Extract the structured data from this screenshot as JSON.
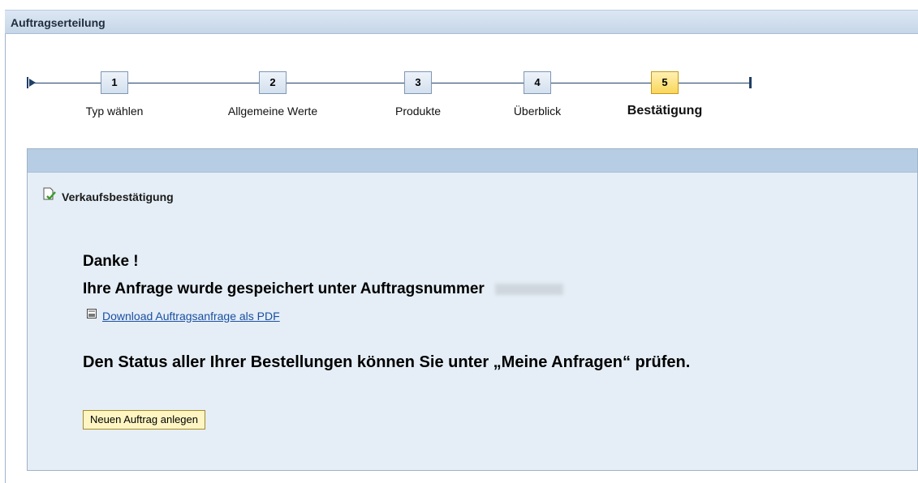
{
  "window": {
    "title": "Auftragserteilung"
  },
  "roadmap": {
    "steps": [
      {
        "number": "1",
        "label": "Typ wählen"
      },
      {
        "number": "2",
        "label": "Allgemeine Werte"
      },
      {
        "number": "3",
        "label": "Produkte"
      },
      {
        "number": "4",
        "label": "Überblick"
      },
      {
        "number": "5",
        "label": "Bestätigung"
      }
    ],
    "active_step": 5
  },
  "confirmation": {
    "section_title": "Verkaufsbestätigung",
    "thanks": "Danke !",
    "saved_text": "Ihre Anfrage wurde gespeichert unter Auftragsnummer",
    "pdf_link": "Download Auftragsanfrage als PDF",
    "status_text": "Den Status aller Ihrer Bestellungen können Sie unter „Meine Anfragen“ prüfen.",
    "new_order_button": "Neuen Auftrag anlegen"
  },
  "icons": {
    "start": "roadmap-start-icon",
    "end": "roadmap-end-icon",
    "section": "document-check-icon",
    "pdf": "pdf-document-icon"
  },
  "colors": {
    "header_bg": "#c6d6e8",
    "panel_bg": "#e5eef6",
    "active_step": "#f9d65a",
    "link": "#1a4fa3",
    "button_bg": "#fff5c2"
  }
}
